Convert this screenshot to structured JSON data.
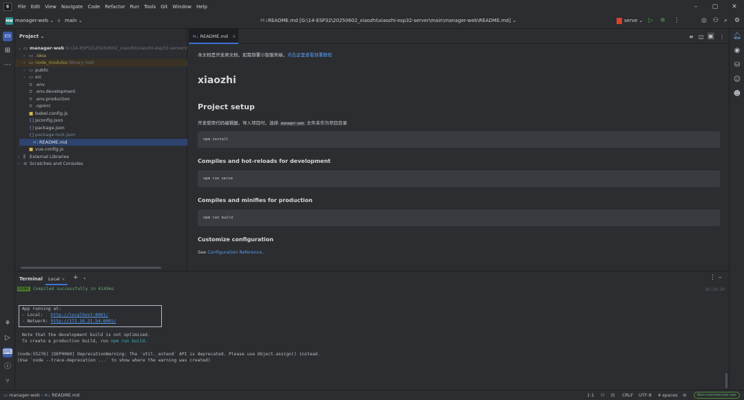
{
  "menu": [
    "File",
    "Edit",
    "View",
    "Navigate",
    "Code",
    "Refactor",
    "Run",
    "Tools",
    "Git",
    "Window",
    "Help"
  ],
  "toolbar": {
    "project_badge": "MW",
    "project_name": "manager-web",
    "branch": "main",
    "file_title": "README.md [G:\\14-ESP32\\20250602_xiaozhi\\xiaozhi-esp32-server\\main\\manager-web\\README.md]",
    "run_config": "serve"
  },
  "project_panel": {
    "title": "Project",
    "root_name": "manager-web",
    "root_path": "G:\\14-ESP32\\20250602_xiaozhi\\xiaozhi-esp32-server\\main",
    "items": [
      {
        "name": ".idea",
        "type": "folder"
      },
      {
        "name": "node_modules",
        "type": "folder",
        "note": "library root"
      },
      {
        "name": "public",
        "type": "folder"
      },
      {
        "name": "src",
        "type": "folder"
      },
      {
        "name": ".env",
        "type": "file"
      },
      {
        "name": ".env.development",
        "type": "file"
      },
      {
        "name": ".env.production",
        "type": "file"
      },
      {
        "name": ".npmrc",
        "type": "file"
      },
      {
        "name": "babel.config.js",
        "type": "js"
      },
      {
        "name": "jsconfig.json",
        "type": "json"
      },
      {
        "name": "package.json",
        "type": "json"
      },
      {
        "name": "package-lock.json",
        "type": "json"
      },
      {
        "name": "README.md",
        "type": "md"
      },
      {
        "name": "vue.config.js",
        "type": "js"
      }
    ],
    "external_libraries": "External Libraries",
    "scratches": "Scratches and Consoles"
  },
  "editor": {
    "tab_label": "README.md",
    "intro_text": "本文档是开发类文档，如需部署小智服务端，",
    "intro_link": "点击这里查看部署教程",
    "h1": "xiaozhi",
    "h2": "Project setup",
    "setup_text_before": "开发使用代码编辑器，导入项目时，选择",
    "setup_code": "manager-web",
    "setup_text_after": "文件夹作为项目目录",
    "code1": "npm install",
    "h3a": "Compiles and hot-reloads for development",
    "code2": "npm run serve",
    "h3b": "Compiles and minifies for production",
    "code3": "npm run build",
    "h3c": "Customize configuration",
    "see_text": "See ",
    "see_link": "Configuration Reference",
    "see_end": "."
  },
  "terminal": {
    "title": "Terminal",
    "tab": "Local",
    "done": "DONE",
    "compiled": "Compiled successfully in 6145ms",
    "time": "16:29:20",
    "app_running": "App running at:",
    "local_label": "- Local:   ",
    "local_url": "http://localhost:8001/",
    "network_label": "- Network: ",
    "network_url": "http://172.16.21.54:8001/",
    "note1": "Note that the development build is not optimized.",
    "note2_before": "To create a production build, run ",
    "note2_cmd": "npm run build",
    "note2_end": ".",
    "warn1": "(node:55276) [DEP0060] DeprecationWarning: The `util._extend` API is deprecated. Please use Object.assign() instead.",
    "warn2": "(Use `node --trace-deprecation ...` to show where the warning was created)"
  },
  "statusbar": {
    "crumb_project": "manager-web",
    "crumb_file": "README.md",
    "position": "1:1",
    "line_sep": "CRLF",
    "encoding": "UTF-8",
    "indent": "4 spaces",
    "license": "Non-commercial use"
  }
}
